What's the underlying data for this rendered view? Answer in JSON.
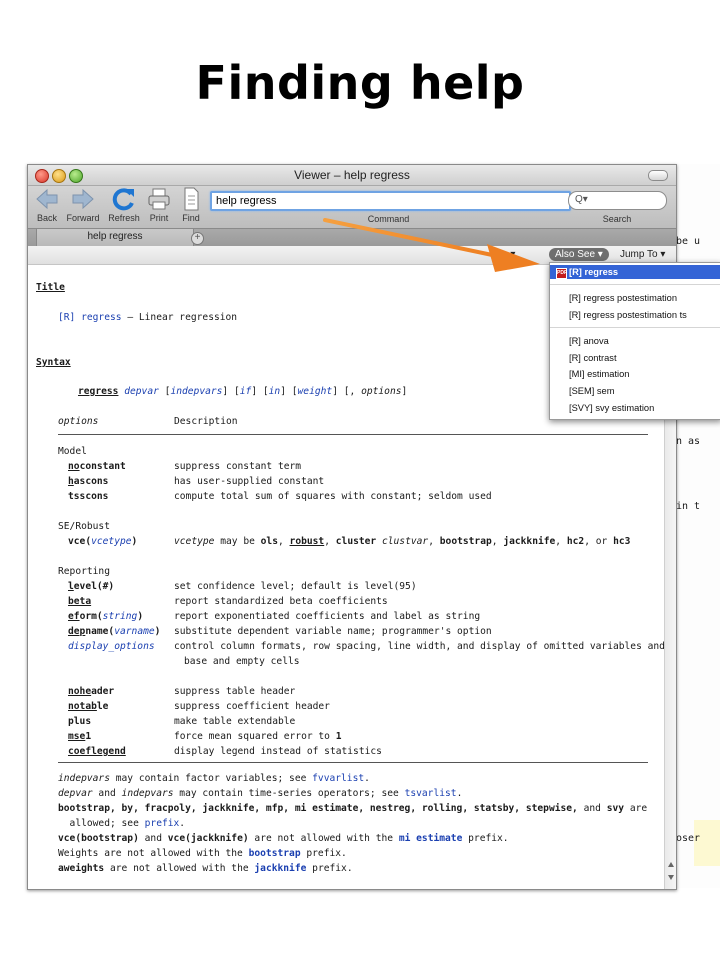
{
  "slide": {
    "title": "Finding help"
  },
  "window": {
    "title": "Viewer – help regress"
  },
  "toolbar": {
    "back": "Back",
    "forward": "Forward",
    "refresh": "Refresh",
    "print": "Print",
    "find": "Find",
    "command_value": "help regress",
    "command_label": "Command",
    "search_placeholder": "Q▾",
    "search_label": "Search"
  },
  "tab": {
    "label": "help regress",
    "add": "+"
  },
  "help_toolbar": {
    "cut_label": "g ▾",
    "also_see": "Also See ▾",
    "jump_to": "Jump To ▾"
  },
  "also_see_menu": {
    "selected": "[R] regress",
    "group1": [
      "[R] regress postestimation",
      "[R] regress postestimation ts"
    ],
    "group2": [
      "[R] anova",
      "[R] contrast",
      "[MI] estimation",
      "[SEM] sem",
      "[SVY] svy estimation"
    ]
  },
  "behind_text": [
    "be u",
    "n as",
    "in t",
    "oser"
  ],
  "colors": {
    "link": "#1a3fb0",
    "menu_selected": "#3464d6",
    "arrow": "#f08a28",
    "input_focus": "#6fa3e3"
  },
  "help": {
    "title_heading": "Title",
    "title_ref": "[R] regress",
    "title_desc": "— Linear regression",
    "syntax_heading": "Syntax",
    "syntax": {
      "cmd": "regress",
      "depvar": "depvar",
      "indepvars": "indepvars",
      "if": "if",
      "in": "in",
      "weight": "weight",
      "options": "options"
    },
    "table_header": {
      "options": "options",
      "description": "Description"
    },
    "model_group": "Model",
    "model": [
      {
        "opt": "noconstant",
        "desc": "suppress constant term"
      },
      {
        "opt": "hascons",
        "desc": "has user-supplied constant"
      },
      {
        "opt": "tsscons",
        "desc": "compute total sum of squares with constant; seldom used"
      }
    ],
    "se_group": "SE/Robust",
    "vce": {
      "opt": "vce(",
      "arg": "vcetype",
      "close": ")",
      "desc_prefix": "vcetype",
      "desc_mid": "may be",
      "ols": "ols",
      "robust": "robust",
      "cluster": "cluster",
      "clustvar": "clustvar",
      "bootstrap": "bootstrap",
      "jackknife": "jackknife",
      "hc2": "hc2",
      "or": "or",
      "hc3": "hc3"
    },
    "reporting_group": "Reporting",
    "reporting": [
      {
        "opt": "level(#)",
        "desc": "set confidence level; default is level(95)"
      },
      {
        "opt": "beta",
        "desc": "report standardized beta coefficients"
      },
      {
        "opt": "eform(string)",
        "desc": "report exponentiated coefficients and label as string"
      },
      {
        "opt": "depname(varname)",
        "desc": "substitute dependent variable name; programmer's option"
      },
      {
        "opt": "display_options",
        "desc": "control column formats, row spacing, line width, and display of omitted variables and"
      }
    ],
    "display_cont": "base and empty cells",
    "extra": [
      {
        "opt": "noheader",
        "desc": "suppress table header"
      },
      {
        "opt": "notable",
        "desc": "suppress coefficient header"
      },
      {
        "opt": "plus",
        "desc": "make table extendable"
      },
      {
        "opt": "msel",
        "desc": "force mean squared error to 1"
      },
      {
        "opt": "coeflegend",
        "desc": "display legend instead of statistics"
      }
    ],
    "notes": {
      "n1_a": "indepvars",
      "n1_b": " may contain factor variables; see ",
      "n1_link": "fvvarlist",
      "n1_c": ".",
      "n2_a": "depvar",
      "n2_b": " and ",
      "n2_c": "indepvars",
      "n2_d": " may contain time-series operators; see ",
      "n2_link": "tsvarlist",
      "n2_e": ".",
      "n3": "bootstrap, by, fracpoly, jackknife, mfp, mi estimate, nestreg, rolling, statsby, stepwise,",
      "n3_and": " and ",
      "n3_svy": "svy",
      "n3_are": " are",
      "n4_a": "  allowed; see ",
      "n4_link": "prefix",
      "n4_b": ".",
      "n5_a": "vce(bootstrap)",
      "n5_b": " and ",
      "n5_c": "vce(jackknife)",
      "n5_d": " are not allowed with the ",
      "n5_link": "mi estimate",
      "n5_e": " prefix.",
      "n6_a": "Weights are not allowed with the ",
      "n6_link": "bootstrap",
      "n6_b": " prefix.",
      "n7_a": "aweights",
      "n7_b": " are not allowed with the ",
      "n7_link": "jackknife",
      "n7_c": " prefix."
    }
  }
}
